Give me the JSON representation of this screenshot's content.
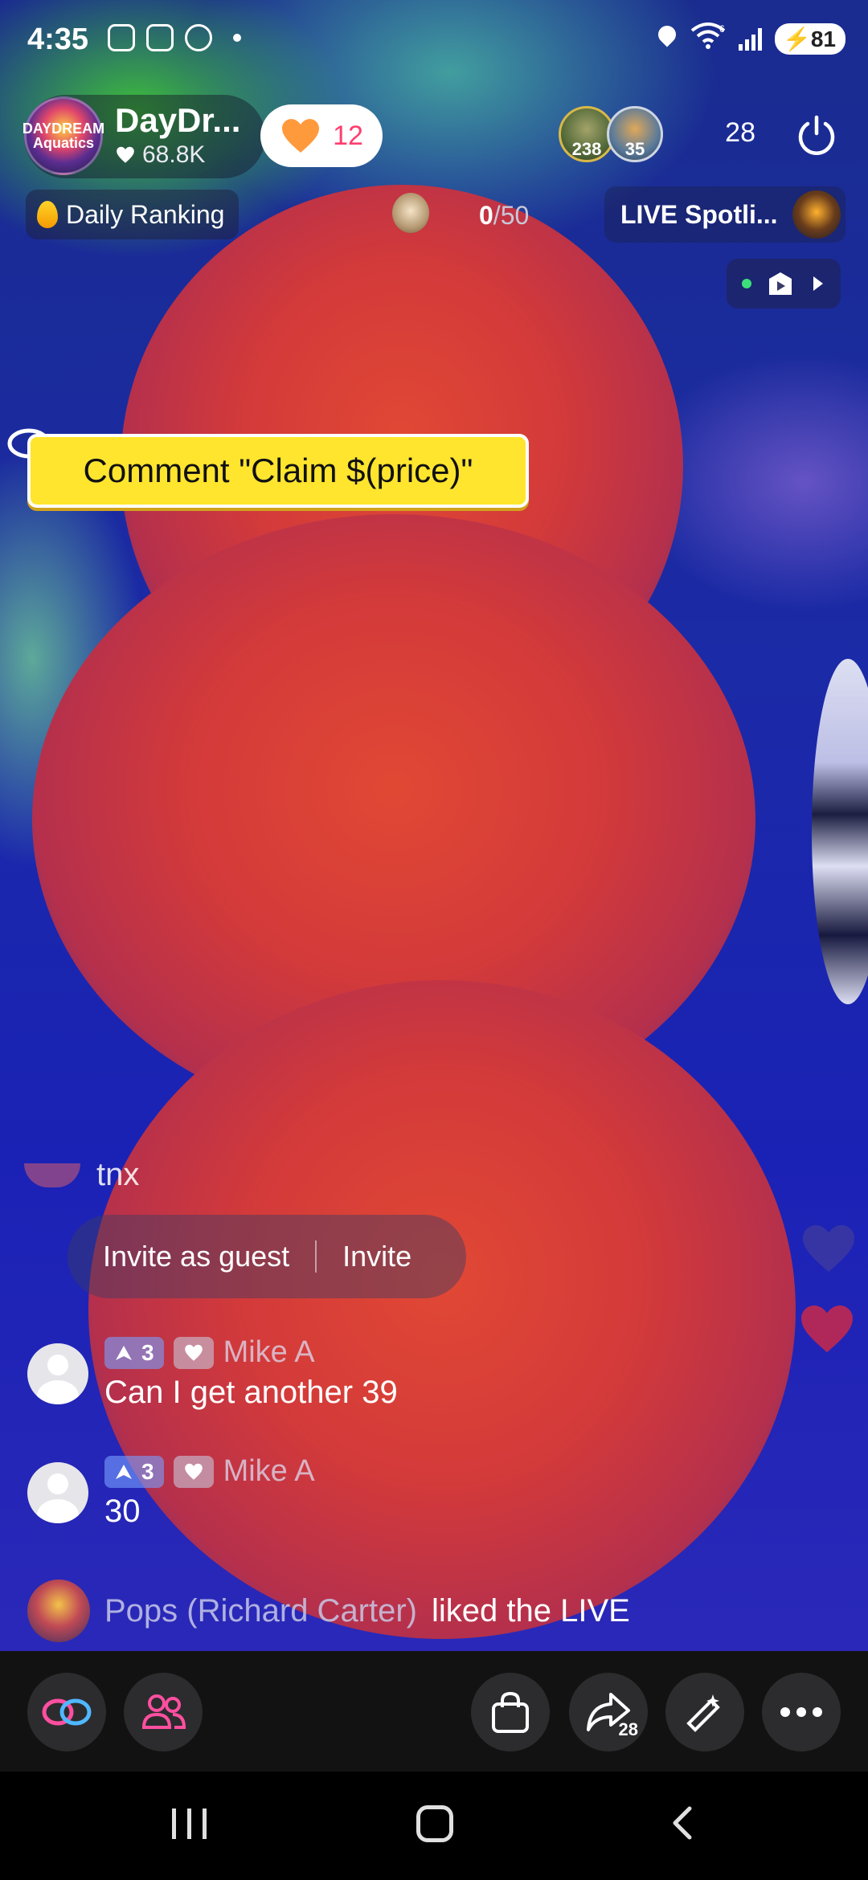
{
  "status_bar": {
    "time": "4:35",
    "wifi_label": "6",
    "battery": "81"
  },
  "host": {
    "name": "DayDr...",
    "likes": "68.8K",
    "avatar_text": "DAYDREAM Aquatics"
  },
  "follow_button": {
    "count": "12"
  },
  "viewers": {
    "avatars": [
      {
        "badge": "238"
      },
      {
        "badge": "35"
      }
    ],
    "count": "28"
  },
  "ranking": {
    "label": "Daily Ranking",
    "goal_current": "0",
    "goal_total": "/50"
  },
  "spotlight": {
    "label": "LIVE Spotli..."
  },
  "sticker": {
    "text": "Comment \"Claim $(price)\""
  },
  "chat": {
    "faded_message": "tnx",
    "invite_as_guest": "Invite as guest",
    "invite": "Invite",
    "comments": [
      {
        "level": "3",
        "user": "Mike A",
        "text": "Can I get another 39"
      },
      {
        "level": "3",
        "user": "Mike A",
        "text": "30"
      }
    ],
    "liked_row": {
      "user": "Pops (Richard Carter)",
      "text": "liked the LIVE"
    }
  },
  "action_bar": {
    "share_count": "28"
  },
  "colors": {
    "sticker_yellow": "#ffe52e",
    "follow_pink": "#ff3d6e",
    "heart_orange": "#ff9a3c",
    "action_pink": "#ff4fa0"
  }
}
